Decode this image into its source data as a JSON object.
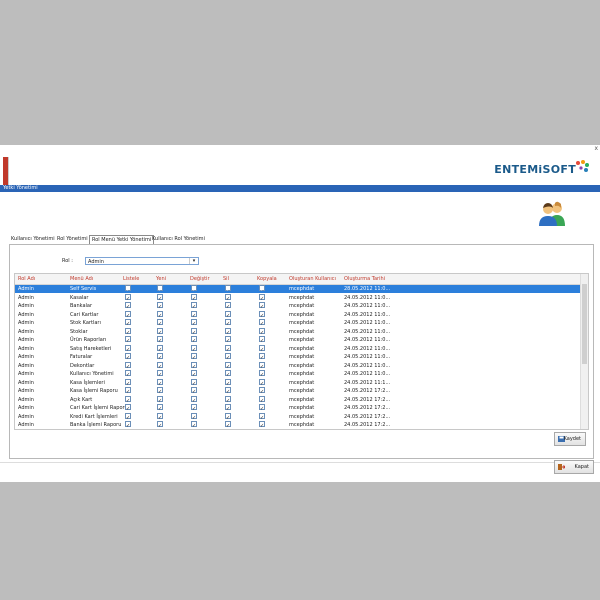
{
  "window": {
    "close_label": "x",
    "title": "Yetki Yönetimi"
  },
  "logo": {
    "text": "ENTEMiSOFT"
  },
  "tabs": [
    {
      "label": "Kullanıcı Yönetimi"
    },
    {
      "label": "Rol Yönetimi"
    },
    {
      "label": "Rol Menü Yetki Yönetimi"
    },
    {
      "label": "Kullanıcı Rol Yönetimi"
    }
  ],
  "rol": {
    "label": "Rol :",
    "value": "Admin"
  },
  "grid": {
    "columns": [
      "Rol Adı",
      "Menü Adı",
      "Listele",
      "Yeni",
      "Değiştir",
      "Sil",
      "Kopyala",
      "Oluşturan Kullanıcı",
      "Oluşturma Tarihi"
    ],
    "rows": [
      {
        "rol": "Admin",
        "menu": "Self Servis",
        "user": "mcephdat",
        "date": "28.05.2012 11:0..."
      },
      {
        "rol": "Admin",
        "menu": "Kasalar",
        "user": "mcephdat",
        "date": "24.05.2012 11:0..."
      },
      {
        "rol": "Admin",
        "menu": "Bankalar",
        "user": "mcephdat",
        "date": "24.05.2012 11:0..."
      },
      {
        "rol": "Admin",
        "menu": "Cari Kartlar",
        "user": "mcephdat",
        "date": "24.05.2012 11:0..."
      },
      {
        "rol": "Admin",
        "menu": "Stok Kartları",
        "user": "mcephdat",
        "date": "24.05.2012 11:0..."
      },
      {
        "rol": "Admin",
        "menu": "Stoklar",
        "user": "mcephdat",
        "date": "24.05.2012 11:0..."
      },
      {
        "rol": "Admin",
        "menu": "Ürün Raporları",
        "user": "mcephdat",
        "date": "24.05.2012 11:0..."
      },
      {
        "rol": "Admin",
        "menu": "Satış Hareketleri",
        "user": "mcephdat",
        "date": "24.05.2012 11:0..."
      },
      {
        "rol": "Admin",
        "menu": "Faturalar",
        "user": "mcephdat",
        "date": "24.05.2012 11:0..."
      },
      {
        "rol": "Admin",
        "menu": "Dekontlar",
        "user": "mcephdat",
        "date": "24.05.2012 11:0..."
      },
      {
        "rol": "Admin",
        "menu": "Kullanıcı Yönetimi",
        "user": "mcephdat",
        "date": "24.05.2012 11:0..."
      },
      {
        "rol": "Admin",
        "menu": "Kasa İşlemleri",
        "user": "mcephdat",
        "date": "24.05.2012 11:1..."
      },
      {
        "rol": "Admin",
        "menu": "Kasa İşlemi Raporu",
        "user": "mcephdat",
        "date": "24.05.2012 17:2..."
      },
      {
        "rol": "Admin",
        "menu": "Açık Kart",
        "user": "mcephdat",
        "date": "24.05.2012 17:2..."
      },
      {
        "rol": "Admin",
        "menu": "Cari Kart İşlemi Raporu",
        "user": "mcephdat",
        "date": "24.05.2012 17:2..."
      },
      {
        "rol": "Admin",
        "menu": "Kredi Kart İşlemleri",
        "user": "mcephdat",
        "date": "24.05.2012 17:2..."
      },
      {
        "rol": "Admin",
        "menu": "Banka İşlemi Raporu",
        "user": "mcephdat",
        "date": "24.05.2012 17:2..."
      }
    ]
  },
  "buttons": {
    "save": "Kaydet",
    "close": "Kapat"
  }
}
